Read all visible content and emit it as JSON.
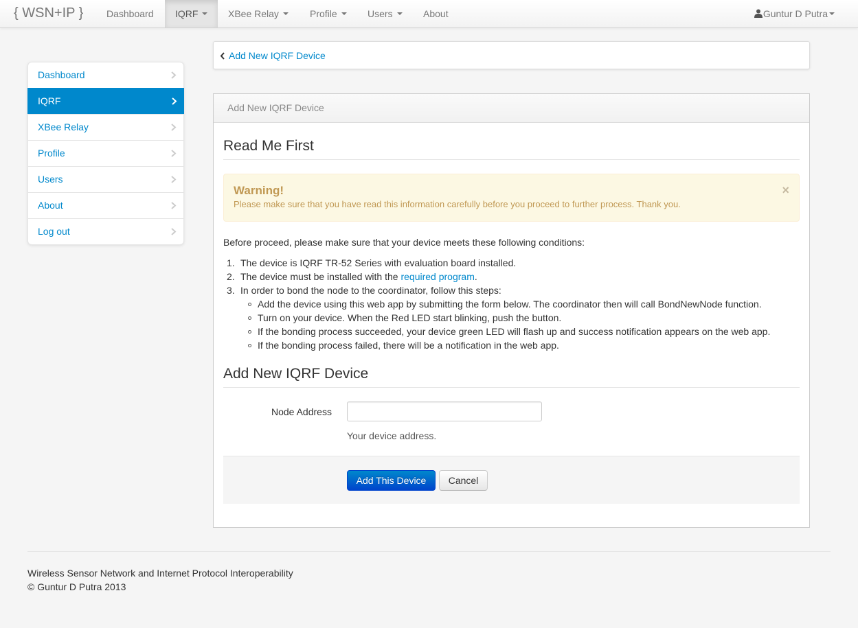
{
  "navbar": {
    "brand": "{ WSN+IP }",
    "items": [
      {
        "label": "Dashboard",
        "dropdown": false
      },
      {
        "label": "IQRF",
        "dropdown": true,
        "active": true
      },
      {
        "label": "XBee Relay",
        "dropdown": true
      },
      {
        "label": "Profile",
        "dropdown": true
      },
      {
        "label": "Users",
        "dropdown": true
      },
      {
        "label": "About",
        "dropdown": false
      }
    ],
    "user": {
      "name": "Guntur D Putra",
      "icon": "user-icon"
    }
  },
  "sidebar": {
    "items": [
      {
        "label": "Dashboard"
      },
      {
        "label": "IQRF",
        "active": true
      },
      {
        "label": "XBee Relay"
      },
      {
        "label": "Profile"
      },
      {
        "label": "Users"
      },
      {
        "label": "About"
      },
      {
        "label": "Log out"
      }
    ]
  },
  "back_link": {
    "label": "Add New IQRF Device",
    "icon": "chevron-left-icon"
  },
  "panel": {
    "header": "Add New IQRF Device",
    "read_me_heading": "Read Me First",
    "alert": {
      "title": "Warning!",
      "text": "Please make sure that you have read this information carefully before you proceed to further process. Thank you.",
      "close": "×"
    },
    "intro": "Before proceed, please make sure that your device meets these following conditions:",
    "conditions": {
      "c1": {
        "num": "1.",
        "text": "The device is IQRF TR-52 Series with evaluation board installed."
      },
      "c2": {
        "num": "2.",
        "before": "The device must be installed with the ",
        "link": "required program",
        "after": "."
      },
      "c3": {
        "num": "3.",
        "text": "In order to bond the node to the coordinator, follow this steps:"
      }
    },
    "steps": [
      "Add the device using this web app by submitting the form below. The coordinator then will call BondNewNode function.",
      "Turn on your device. When the Red LED start blinking, push the button.",
      "If the bonding process succeeded, your device green LED will flash up and success notification appears on the web app.",
      "If the bonding process failed, there will be a notification in the web app."
    ],
    "form_heading": "Add New IQRF Device",
    "form": {
      "node_label": "Node Address",
      "node_value": "",
      "node_placeholder": "",
      "node_help": "Your device address.",
      "submit_label": "Add This Device",
      "cancel_label": "Cancel"
    }
  },
  "footer": {
    "line1": "Wireless Sensor Network and Internet Protocol Interoperability",
    "line2": "© Guntur D Putra 2013"
  },
  "colors": {
    "link": "#0088cc",
    "active_sidebar": "#0088cc",
    "alert_bg": "#fcf8e3",
    "alert_text": "#c09853",
    "primary_button": "#0055cc"
  }
}
